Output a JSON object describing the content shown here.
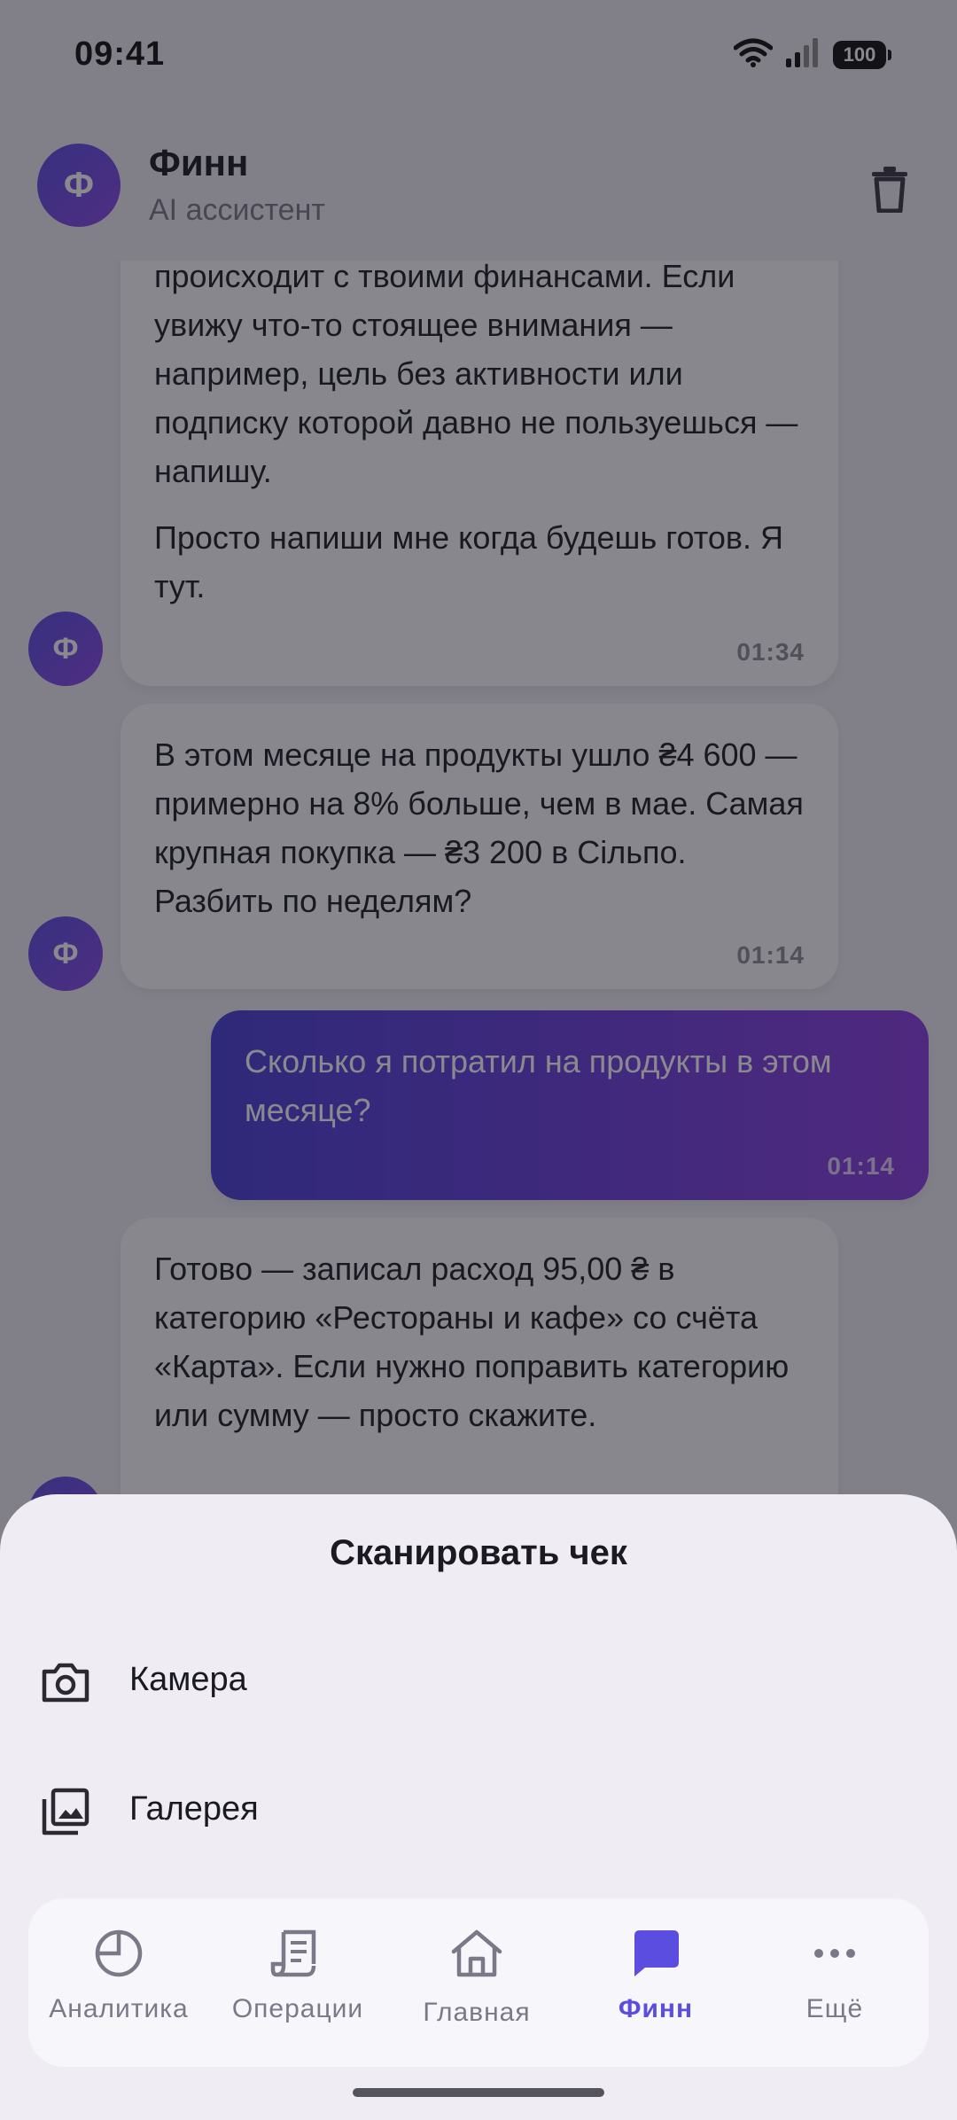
{
  "status": {
    "time": "09:41",
    "battery": "100"
  },
  "header": {
    "avatar_letter": "Ф",
    "name": "Финн",
    "subtitle": "AI ассистент"
  },
  "messages": [
    {
      "lines": [
        "происходит с твоими финансами. Если увижу что-то стоящее внимания — например, цель без активности или подписку которой давно не пользуешься — напишу."
      ],
      "extra": "Просто напиши мне когда будешь готов. Я тут.",
      "time": "01:34",
      "avatar": "Ф"
    },
    {
      "text": "В этом месяце на продукты ушло ₴4 600 — примерно на 8% больше, чем в мае. Самая крупная покупка — ₴3 200 в Сільпо. Разбить по неделям?",
      "time": "01:14",
      "avatar": "Ф"
    },
    {
      "text": "Сколько я потратил на продукты в этом месяце?",
      "time": "01:14",
      "from": "user"
    },
    {
      "text": "Готово — записал расход 95,00 ₴ в категорию «Рестораны и кафе» со счёта «Карта». Если нужно поправить категорию или сумму — просто скажите.",
      "avatar": "Ф"
    }
  ],
  "sheet": {
    "title": "Сканировать чек",
    "items": [
      {
        "label": "Камера",
        "icon": "camera-icon"
      },
      {
        "label": "Галерея",
        "icon": "gallery-icon"
      }
    ]
  },
  "tabs": [
    {
      "label": "Аналитика",
      "icon": "pie-chart-icon"
    },
    {
      "label": "Операции",
      "icon": "receipt-icon"
    },
    {
      "label": "Главная",
      "icon": "home-icon"
    },
    {
      "label": "Финн",
      "icon": "chat-icon",
      "active": true
    },
    {
      "label": "Ещё",
      "icon": "more-icon"
    }
  ],
  "colors": {
    "accent": "#5b4de0",
    "user_bubble_end": "#8a3fe0"
  }
}
